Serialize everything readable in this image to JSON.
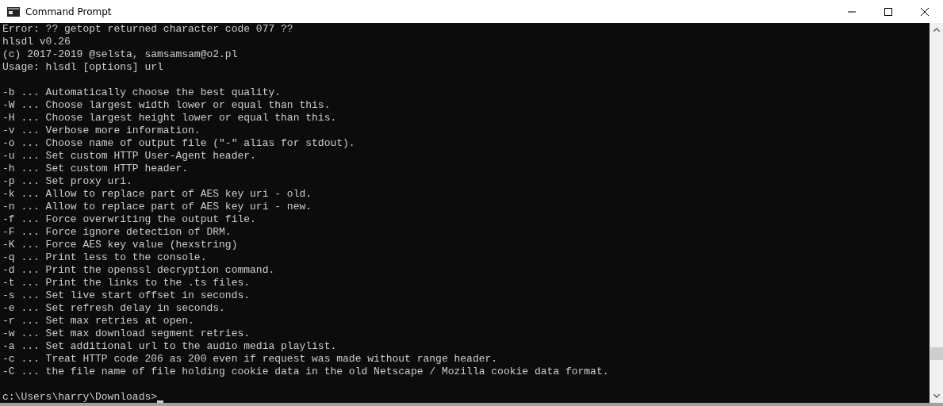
{
  "window": {
    "title": "Command Prompt"
  },
  "console": {
    "header": [
      "Error: ?? getopt returned character code 077 ??",
      "hlsdl v0.26",
      "(c) 2017-2019 @selsta, samsamsam@o2.pl",
      "Usage: hlsdl [options] url"
    ],
    "options": [
      "-b ... Automatically choose the best quality.",
      "-W ... Choose largest width lower or equal than this.",
      "-H ... Choose largest height lower or equal than this.",
      "-v ... Verbose more information.",
      "-o ... Choose name of output file (\"-\" alias for stdout).",
      "-u ... Set custom HTTP User-Agent header.",
      "-h ... Set custom HTTP header.",
      "-p ... Set proxy uri.",
      "-k ... Allow to replace part of AES key uri - old.",
      "-n ... Allow to replace part of AES key uri - new.",
      "-f ... Force overwriting the output file.",
      "-F ... Force ignore detection of DRM.",
      "-K ... Force AES key value (hexstring)",
      "-q ... Print less to the console.",
      "-d ... Print the openssl decryption command.",
      "-t ... Print the links to the .ts files.",
      "-s ... Set live start offset in seconds.",
      "-e ... Set refresh delay in seconds.",
      "-r ... Set max retries at open.",
      "-w ... Set max download segment retries.",
      "-a ... Set additional url to the audio media playlist.",
      "-c ... Treat HTTP code 206 as 200 even if request was made without range header.",
      "-C ... the file name of file holding cookie data in the old Netscape / Mozilla cookie data format."
    ],
    "prompt": "c:\\Users\\harry\\Downloads>"
  }
}
